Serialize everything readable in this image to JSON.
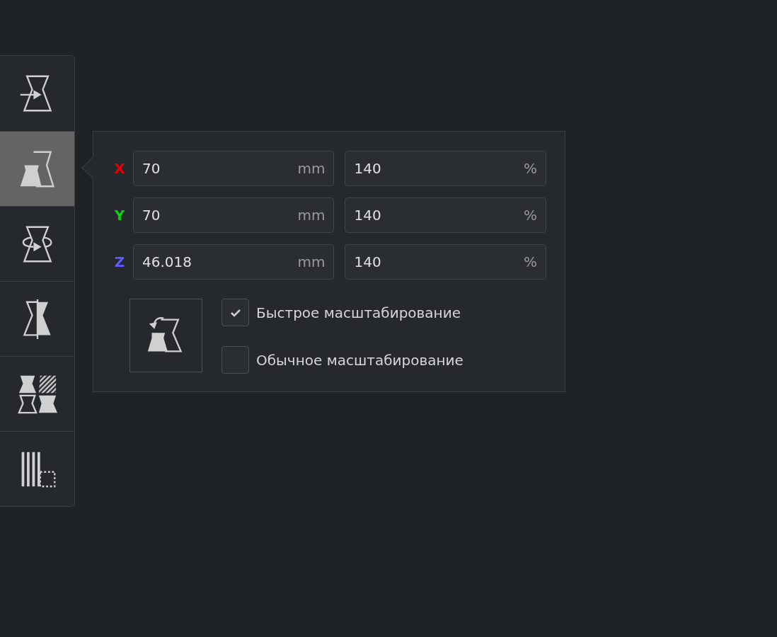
{
  "toolbar": [
    {
      "kind": "move",
      "selected": false
    },
    {
      "kind": "scale",
      "selected": true
    },
    {
      "kind": "rotate",
      "selected": false
    },
    {
      "kind": "mirror",
      "selected": false
    },
    {
      "kind": "per_model",
      "selected": false
    },
    {
      "kind": "support",
      "selected": false
    }
  ],
  "scale_panel": {
    "axes": [
      {
        "label": "X",
        "color": "#e80000",
        "size": "70",
        "size_unit": "mm",
        "percent": "140",
        "percent_unit": "%"
      },
      {
        "label": "Y",
        "color": "#00d800",
        "size": "70",
        "size_unit": "mm",
        "percent": "140",
        "percent_unit": "%"
      },
      {
        "label": "Z",
        "color": "#5c5cff",
        "size": "46.018",
        "size_unit": "mm",
        "percent": "140",
        "percent_unit": "%"
      }
    ],
    "options": [
      {
        "label": "Быстрое масштабирование",
        "checked": true
      },
      {
        "label": "Обычное масштабирование",
        "checked": false
      }
    ]
  }
}
